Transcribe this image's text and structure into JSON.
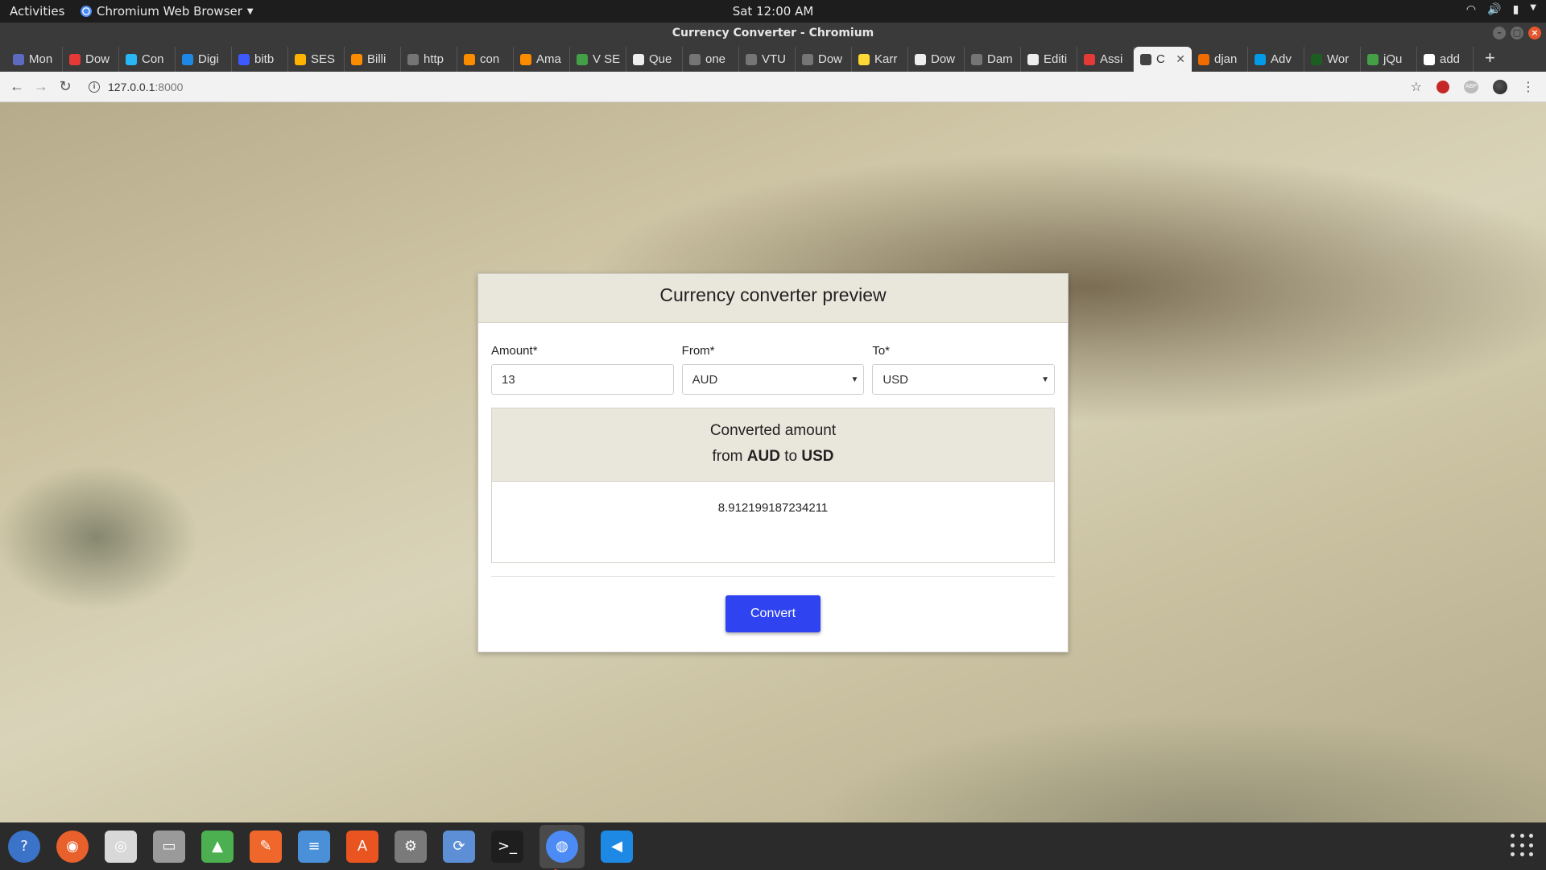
{
  "system": {
    "activities": "Activities",
    "app_menu": "Chromium Web Browser",
    "clock": "Sat 12:00 AM"
  },
  "window": {
    "title": "Currency Converter - Chromium"
  },
  "tabs": [
    {
      "label": "Mon",
      "color": "#5c6bc0"
    },
    {
      "label": "Dow",
      "color": "#e53935"
    },
    {
      "label": "Con",
      "color": "#29b6f6"
    },
    {
      "label": "Digi",
      "color": "#1e88e5"
    },
    {
      "label": "bitb",
      "color": "#3d5afe"
    },
    {
      "label": "SES",
      "color": "#ffb300"
    },
    {
      "label": "Billi",
      "color": "#fb8c00"
    },
    {
      "label": "http",
      "color": "#757575"
    },
    {
      "label": "con",
      "color": "#fb8c00"
    },
    {
      "label": "Ama",
      "color": "#fb8c00"
    },
    {
      "label": "V SE",
      "color": "#43a047"
    },
    {
      "label": "Que",
      "color": "#eeeeee"
    },
    {
      "label": "one",
      "color": "#757575"
    },
    {
      "label": "VTU",
      "color": "#757575"
    },
    {
      "label": "Dow",
      "color": "#757575"
    },
    {
      "label": "Karr",
      "color": "#fdd835"
    },
    {
      "label": "Dow",
      "color": "#eeeeee"
    },
    {
      "label": "Dam",
      "color": "#757575"
    },
    {
      "label": "Editi",
      "color": "#eeeeee"
    },
    {
      "label": "Assi",
      "color": "#e53935"
    },
    {
      "label": "C",
      "color": "#424242",
      "active": true
    },
    {
      "label": "djan",
      "color": "#ef6c00"
    },
    {
      "label": "Adv",
      "color": "#039be5"
    },
    {
      "label": "Wor",
      "color": "#1b5e20"
    },
    {
      "label": "jQu",
      "color": "#43a047"
    },
    {
      "label": "add",
      "color": "#ffffff"
    }
  ],
  "address": {
    "host": "127.0.0.1",
    "port": ":8000"
  },
  "converter": {
    "title": "Currency converter preview",
    "amount_label": "Amount*",
    "amount_value": "13",
    "from_label": "From*",
    "from_value": "AUD",
    "to_label": "To*",
    "to_value": "USD",
    "result_title": "Converted amount",
    "result_from_word": "from",
    "result_from": "AUD",
    "result_to_word": "to",
    "result_to": "USD",
    "result_value": "8.912199187234211",
    "convert_label": "Convert",
    "accent": "#2f44f0"
  },
  "dock": [
    {
      "name": "help-icon",
      "glyph": "?",
      "bg": "#3b73c8"
    },
    {
      "name": "firefox-icon",
      "glyph": "◉",
      "bg": "#e8602c"
    },
    {
      "name": "rhythmbox-icon",
      "glyph": "◎",
      "bg": "#d8d8d8"
    },
    {
      "name": "files-icon",
      "glyph": "▭",
      "bg": "#9a9a9a"
    },
    {
      "name": "android-studio-icon",
      "glyph": "▲",
      "bg": "#4caf50"
    },
    {
      "name": "inkscape-icon",
      "glyph": "✎",
      "bg": "#f0672c"
    },
    {
      "name": "text-editor-icon",
      "glyph": "≡",
      "bg": "#4a90d9"
    },
    {
      "name": "software-center-icon",
      "glyph": "A",
      "bg": "#e95420"
    },
    {
      "name": "settings-icon",
      "glyph": "⚙",
      "bg": "#7a7a7a"
    },
    {
      "name": "update-icon",
      "glyph": "⟳",
      "bg": "#5d8fd6"
    },
    {
      "name": "terminal-icon",
      "glyph": ">_",
      "bg": "#1e1e1e"
    },
    {
      "name": "chromium-icon",
      "glyph": "◍",
      "bg": "#4c8bf5",
      "active": true
    },
    {
      "name": "vscode-icon",
      "glyph": "◀",
      "bg": "#1e88e5"
    }
  ]
}
